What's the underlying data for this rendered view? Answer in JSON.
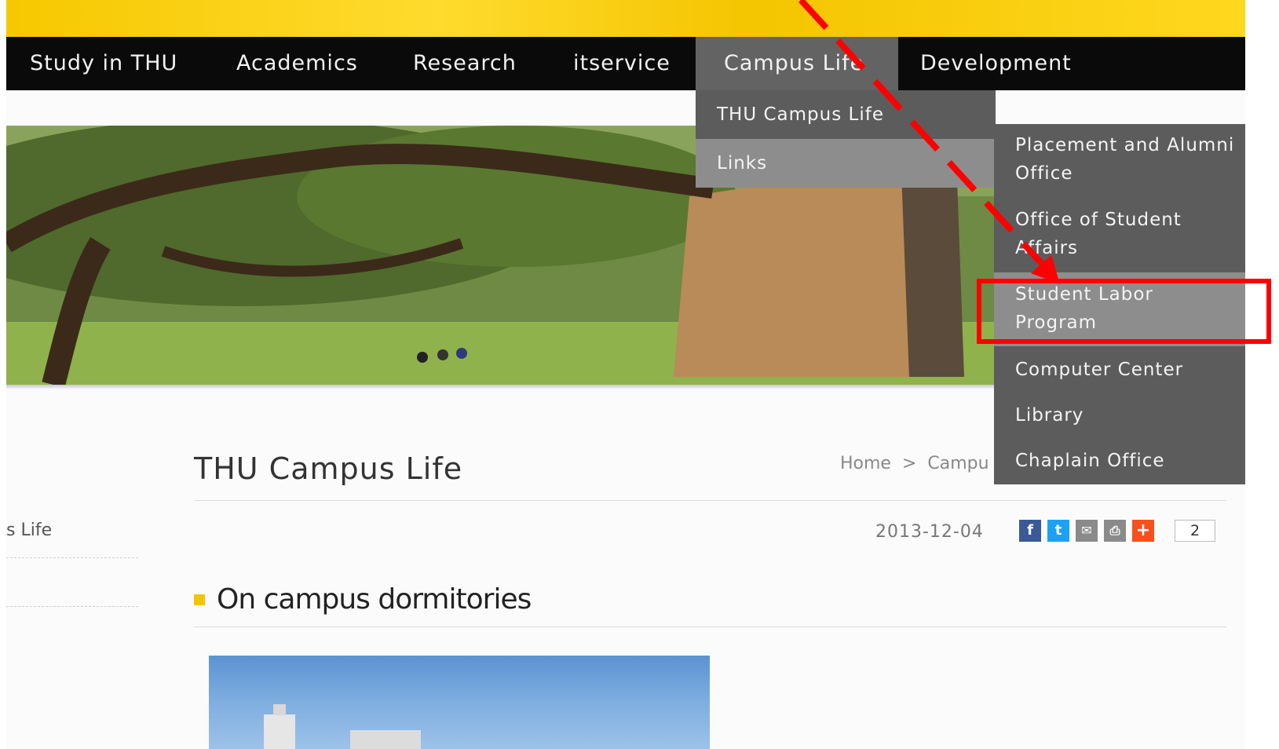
{
  "nav": {
    "items": [
      {
        "label": "Study in THU"
      },
      {
        "label": "Academics"
      },
      {
        "label": "Research"
      },
      {
        "label": "itservice"
      },
      {
        "label": "Campus Life"
      },
      {
        "label": "Development"
      }
    ],
    "active": "Campus Life"
  },
  "dropdown_campus_life": {
    "items": [
      {
        "label": "THU Campus Life"
      },
      {
        "label": "Links"
      }
    ],
    "highlighted": "Links"
  },
  "dropdown_links": {
    "items": [
      {
        "label": "Placement and Alumni Office"
      },
      {
        "label": "Office of Student Affairs"
      },
      {
        "label": "Student Labor Program"
      },
      {
        "label": "Computer Center"
      },
      {
        "label": "Library"
      },
      {
        "label": "Chaplain Office"
      }
    ],
    "highlighted": "Student Labor Program"
  },
  "page": {
    "title": "THU Campus Life",
    "breadcrumb": [
      "Home",
      ">",
      "Campu"
    ],
    "sidebar_item": "s Life",
    "date": "2013-12-04",
    "share_count": "2",
    "section_heading": "On campus dormitories"
  },
  "share_icons": [
    {
      "icon": "facebook-icon",
      "glyph": "f",
      "color": "#3b5998"
    },
    {
      "icon": "twitter-icon",
      "glyph": "t",
      "color": "#1da1f2"
    },
    {
      "icon": "email-icon",
      "glyph": "✉",
      "color": "#8a8a8a"
    },
    {
      "icon": "print-icon",
      "glyph": "⎙",
      "color": "#8a8a8a"
    },
    {
      "icon": "plus-icon",
      "glyph": "+",
      "color": "#f4511e"
    }
  ],
  "colors": {
    "banner_yellow": "#f6c800",
    "nav_black": "#0a0a0a",
    "menu_gray": "#5c5c5c",
    "menu_highlight": "#8d8d8d",
    "annotation_red": "#ff0000",
    "bullet_yellow": "#f3c500"
  }
}
